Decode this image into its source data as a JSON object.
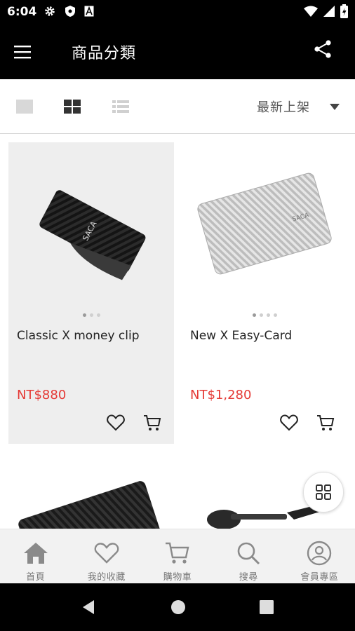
{
  "status_bar": {
    "time": "6:04"
  },
  "header": {
    "title": "商品分類"
  },
  "toolbar": {
    "sort": {
      "selected": "最新上架"
    }
  },
  "products": [
    {
      "name": "Classic X money clip",
      "price": "NT$880",
      "image_icon": "money-clip-image",
      "dots": 3,
      "active_dot": 0
    },
    {
      "name": "New X Easy-Card",
      "price": "NT$1,280",
      "image_icon": "easy-card-image",
      "dots": 4,
      "active_dot": 0
    }
  ],
  "bottom_nav": {
    "items": [
      {
        "label": "首頁",
        "icon": "home-icon"
      },
      {
        "label": "我的收藏",
        "icon": "heart-icon"
      },
      {
        "label": "購物車",
        "icon": "cart-icon"
      },
      {
        "label": "搜尋",
        "icon": "search-icon"
      },
      {
        "label": "會員專區",
        "icon": "account-icon"
      }
    ]
  },
  "colors": {
    "price": "#e53935",
    "header_bg": "#000000",
    "selected_card_bg": "#eeeeee",
    "nav_bg": "#f2f2f2"
  }
}
